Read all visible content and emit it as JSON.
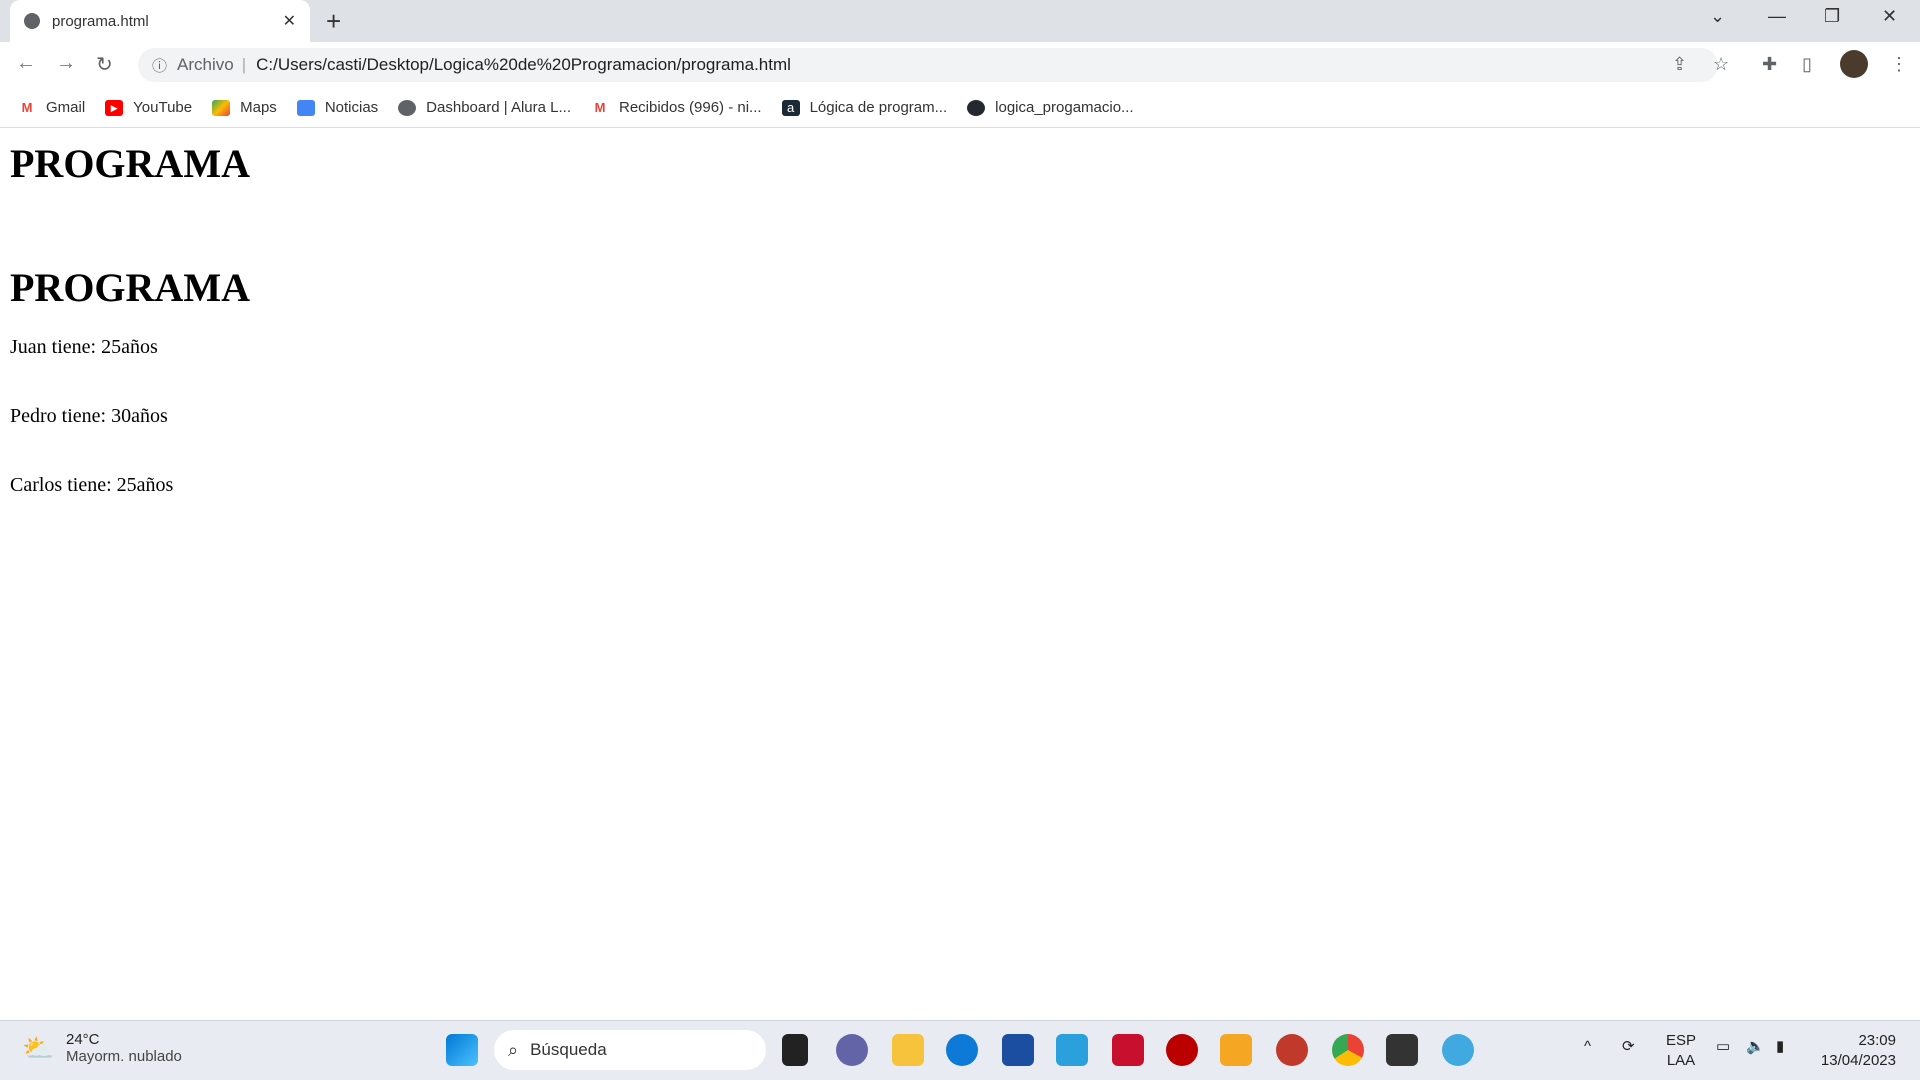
{
  "browser": {
    "tab_title": "programa.html",
    "new_tab": "+",
    "close_tab": "✕",
    "address_label": "Archivo",
    "url": "C:/Users/casti/Desktop/Logica%20de%20Programacion/programa.html",
    "bookmarks": [
      {
        "label": "Gmail",
        "icon": "gmail-icon",
        "color": "#ea4335"
      },
      {
        "label": "YouTube",
        "icon": "youtube-icon",
        "color": "#ff0000"
      },
      {
        "label": "Maps",
        "icon": "maps-icon",
        "color": "#34a853"
      },
      {
        "label": "Noticias",
        "icon": "news-icon",
        "color": "#4285f4"
      },
      {
        "label": "Dashboard | Alura L...",
        "icon": "globe-icon",
        "color": "#5f6368"
      },
      {
        "label": "Recibidos (996) - ni...",
        "icon": "gmail-icon",
        "color": "#ea4335"
      },
      {
        "label": "Lógica de program...",
        "icon": "alura-icon",
        "color": "#1c2a36"
      },
      {
        "label": "logica_progamacio...",
        "icon": "github-icon",
        "color": "#24292f"
      }
    ]
  },
  "page": {
    "heading1": "PROGRAMA",
    "heading2": "PROGRAMA",
    "lines": [
      "Juan tiene: 25años",
      "Pedro tiene: 30años",
      "Carlos tiene: 25años"
    ]
  },
  "taskbar": {
    "temperature": "24°C",
    "weather": "Mayorm. nublado",
    "search_placeholder": "Búsqueda",
    "lang_top": "ESP",
    "lang_bottom": "LAA",
    "time": "23:09",
    "date": "13/04/2023"
  }
}
